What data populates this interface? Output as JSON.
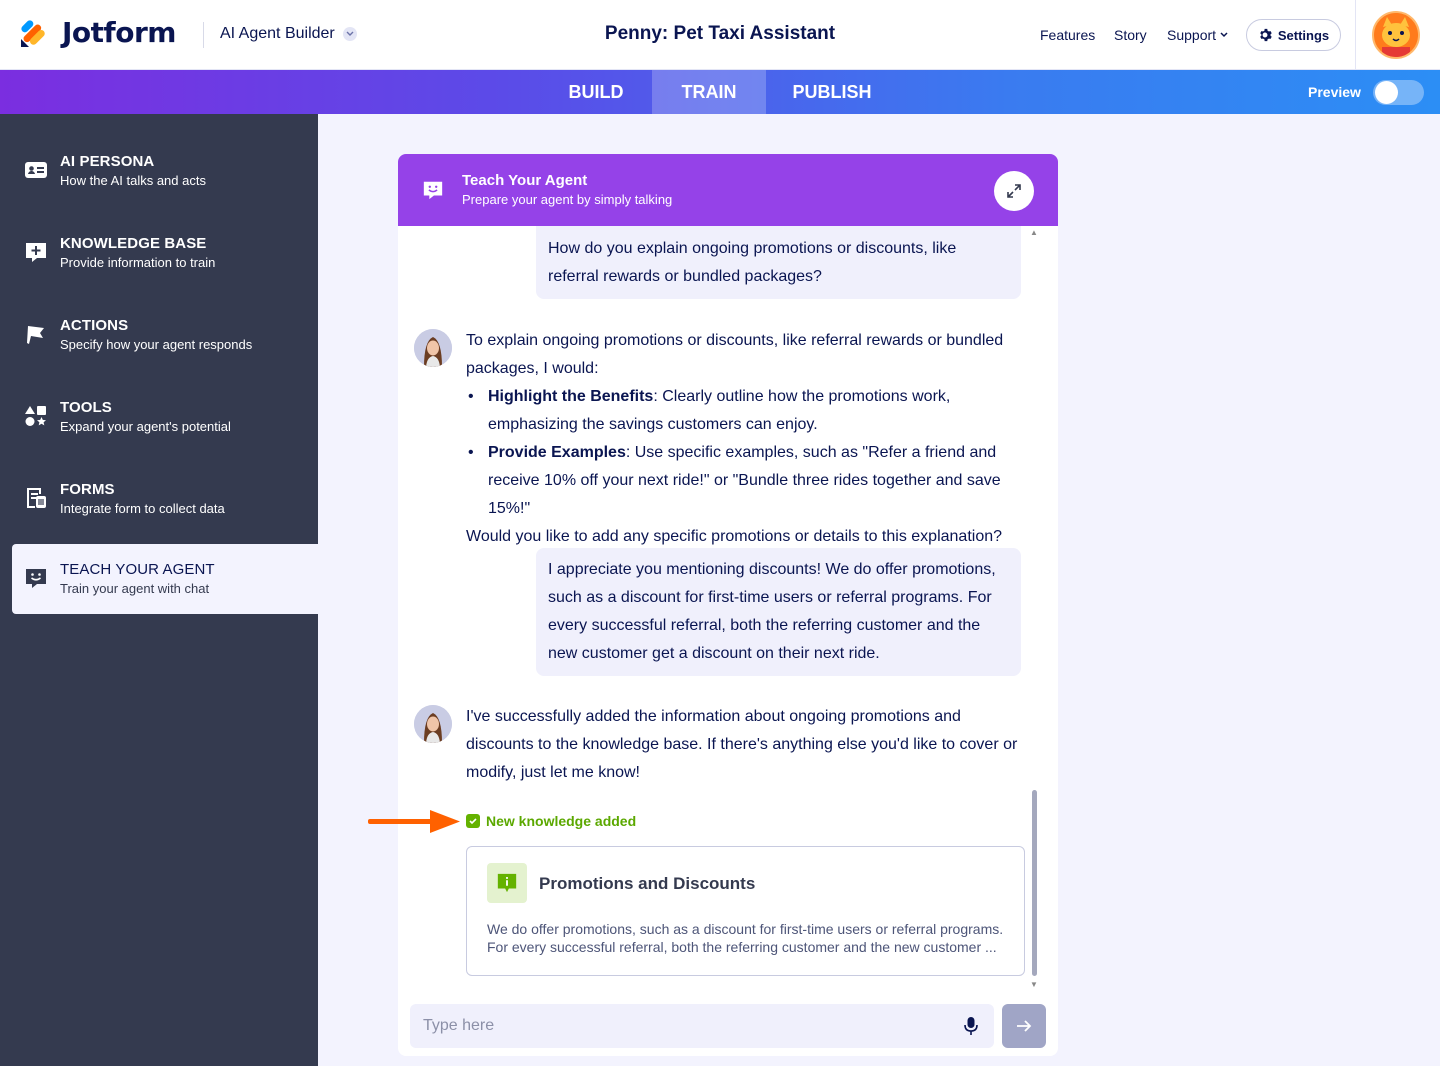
{
  "header": {
    "brand": "Jotform",
    "product": "AI Agent Builder",
    "title": "Penny: Pet Taxi Assistant",
    "nav": [
      "Features",
      "Story",
      "Support"
    ],
    "settings_label": "Settings"
  },
  "tabs": [
    {
      "label": "BUILD",
      "active": false
    },
    {
      "label": "TRAIN",
      "active": true
    },
    {
      "label": "PUBLISH",
      "active": false
    }
  ],
  "preview_label": "Preview",
  "preview_enabled": false,
  "sidebar": {
    "items": [
      {
        "title": "AI PERSONA",
        "subtitle": "How the AI talks and acts",
        "icon": "id-card-icon"
      },
      {
        "title": "KNOWLEDGE BASE",
        "subtitle": "Provide information to train",
        "icon": "knowledge-plus-icon"
      },
      {
        "title": "ACTIONS",
        "subtitle": "Specify how your agent responds",
        "icon": "flag-icon"
      },
      {
        "title": "TOOLS",
        "subtitle": "Expand your agent's potential",
        "icon": "shapes-icon"
      },
      {
        "title": "FORMS",
        "subtitle": "Integrate form to collect data",
        "icon": "form-icon"
      },
      {
        "title": "TEACH YOUR AGENT",
        "subtitle": "Train your agent with chat",
        "icon": "chat-smile-icon",
        "active": true
      }
    ]
  },
  "panel": {
    "title": "Teach Your Agent",
    "subtitle": "Prepare your agent by simply talking"
  },
  "messages": {
    "user1": "How do you explain ongoing promotions or discounts, like referral rewards or bundled packages?",
    "bot1_intro": "To explain ongoing promotions or discounts, like referral rewards or bundled packages, I would:",
    "bot1_b1_bold": "Highlight the Benefits",
    "bot1_b1_text": ": Clearly outline how the promotions work, emphasizing the savings customers can enjoy.",
    "bot1_b2_bold": "Provide Examples",
    "bot1_b2_text": ": Use specific examples, such as \"Refer a friend and receive 10% off your next ride!\" or \"Bundle three rides together and save 15%!\"",
    "bot1_outro": "Would you like to add any specific promotions or details to this explanation?",
    "user2": "I appreciate you mentioning discounts! We do offer promotions, such as a discount for first-time users or referral programs. For every successful referral, both the referring customer and the new customer get a discount on their next ride.",
    "bot2": "I've successfully added the information about ongoing promotions and discounts to the knowledge base. If there's anything else you'd like to cover or modify, just let me know!"
  },
  "knowledge": {
    "tag": "New knowledge added",
    "card_title": "Promotions and Discounts",
    "card_body": "We do offer promotions, such as a discount for first-time users or referral programs. For every successful referral, both the referring customer and the new customer ..."
  },
  "input": {
    "placeholder": "Type here",
    "value": ""
  },
  "colors": {
    "tab_gradient_start": "#7b2ee0",
    "tab_gradient_end": "#2c8ef5",
    "sidebar_bg": "#343a4f",
    "panel_header": "#9542e8",
    "success": "#64b200",
    "annotation_arrow": "#ff6100"
  }
}
